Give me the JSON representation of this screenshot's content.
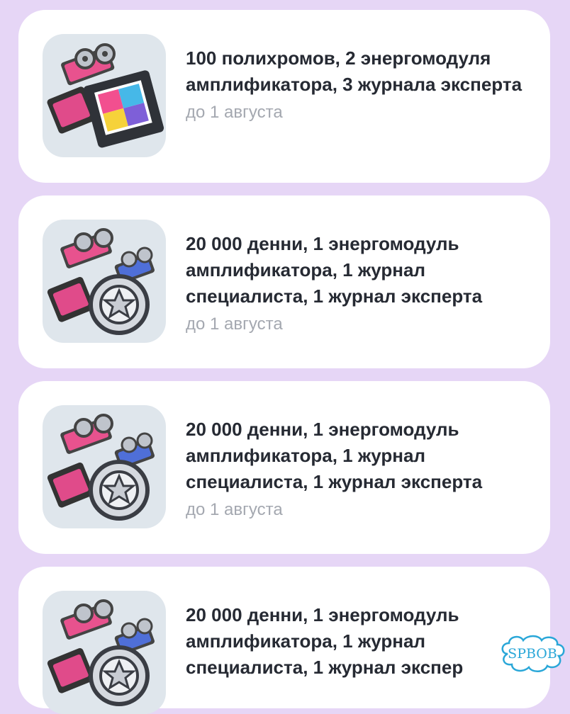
{
  "offers": [
    {
      "title": "100 полихромов, 2 энергомодуля амплификатора, 3 журнала эксперта",
      "date": "до 1 августа",
      "icon": "film-reels-icon"
    },
    {
      "title": "20 000 денни, 1 энергомодуль амплификатора, 1 журнал специалиста, 1 журнал эксперта",
      "date": "до 1 августа",
      "icon": "reels-and-wheel-icon"
    },
    {
      "title": "20 000 денни, 1 энергомодуль амплификатора, 1 журнал специалиста, 1 журнал эксперта",
      "date": "до 1 августа",
      "icon": "reels-and-wheel-icon"
    },
    {
      "title": "20 000 денни, 1 энергомодуль амплификатора, 1 журнал специалиста, 1 журнал экспер",
      "date": "",
      "icon": "reels-and-wheel-icon"
    }
  ],
  "watermark": {
    "text": "SPBOB"
  },
  "colors": {
    "background": "#e6d6f6",
    "card": "#ffffff",
    "title": "#262a33",
    "date": "#a4a8b0",
    "thumb_bg": "#dfe6ec"
  }
}
